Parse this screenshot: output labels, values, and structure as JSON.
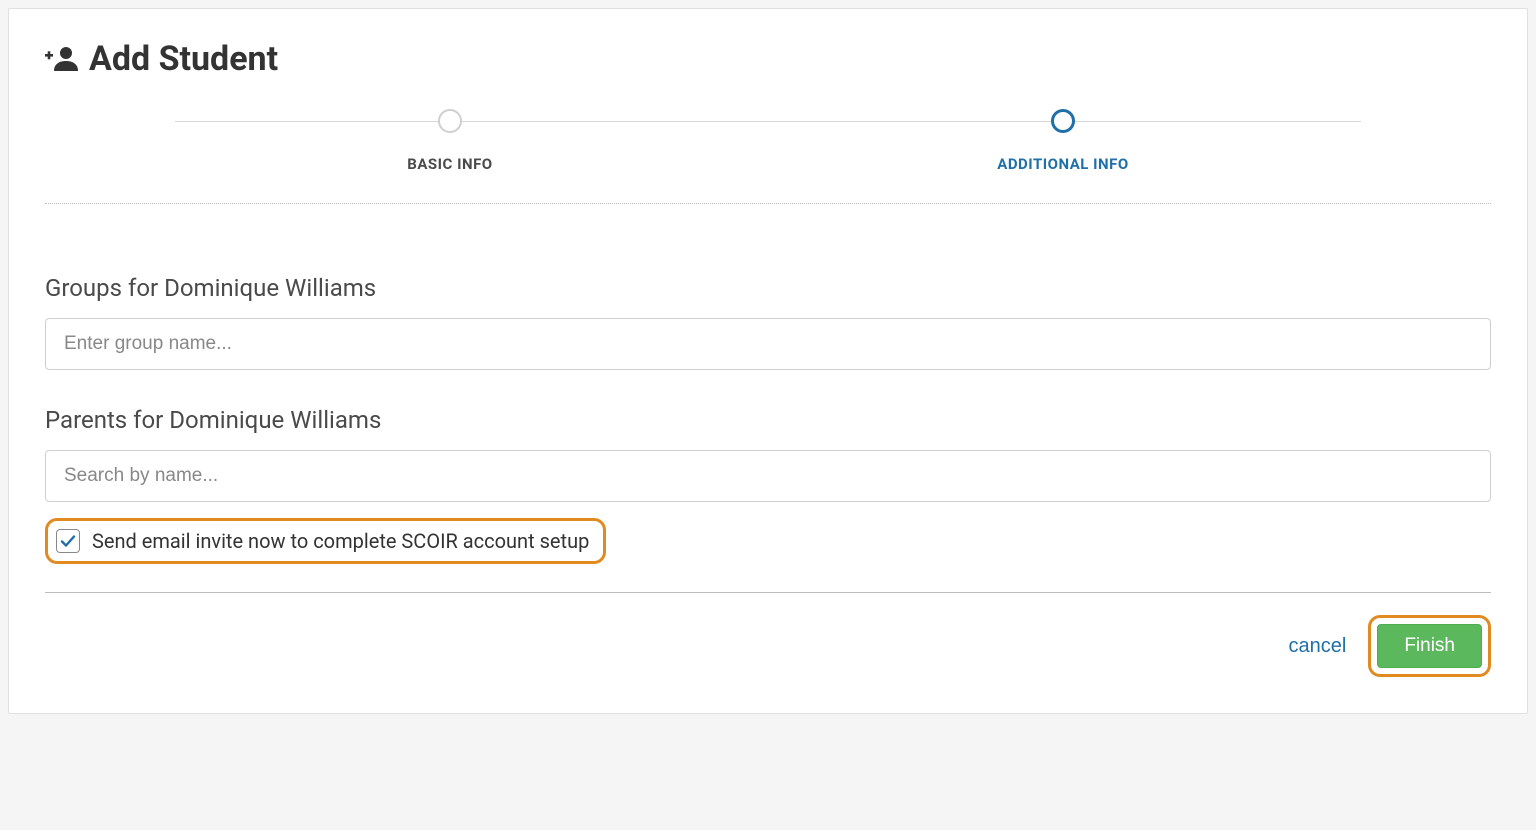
{
  "page": {
    "title": "Add Student"
  },
  "stepper": {
    "steps": [
      {
        "label": "BASIC INFO",
        "active": false
      },
      {
        "label": "ADDITIONAL INFO",
        "active": true
      }
    ]
  },
  "groups": {
    "label": "Groups for Dominique Williams",
    "placeholder": "Enter group name..."
  },
  "parents": {
    "label": "Parents for Dominique Williams",
    "placeholder": "Search by name..."
  },
  "invite": {
    "label": "Send email invite now to complete SCOIR account setup",
    "checked": true
  },
  "actions": {
    "cancel": "cancel",
    "finish": "Finish"
  }
}
